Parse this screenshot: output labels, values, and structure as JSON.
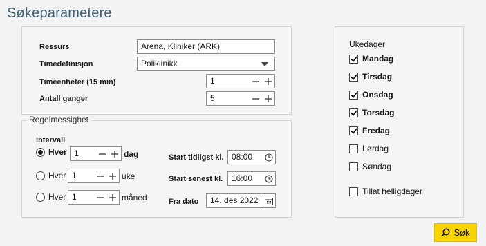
{
  "page": {
    "title": "Søkeparametere"
  },
  "params": {
    "ressurs_label": "Ressurs",
    "ressurs_value": "Arena, Kliniker (ARK)",
    "timedef_label": "Timedefinisjon",
    "timedef_value": "Poliklinikk",
    "timeenheter_label": "Timeenheter (15 min)",
    "timeenheter_value": "1",
    "antall_label": "Antall ganger",
    "antall_value": "5"
  },
  "regel": {
    "group_title": "Regelmessighet",
    "intervall_label": "Intervall",
    "rows": [
      {
        "prefix": "Hver",
        "value": "1",
        "unit": "dag",
        "selected": true
      },
      {
        "prefix": "Hver",
        "value": "1",
        "unit": "uke",
        "selected": false
      },
      {
        "prefix": "Hver",
        "value": "1",
        "unit": "måned",
        "selected": false
      }
    ],
    "start_tidligst_label": "Start tidligst kl.",
    "start_tidligst_value": "08:00",
    "start_senest_label": "Start senest kl.",
    "start_senest_value": "16:00",
    "fra_dato_label": "Fra dato",
    "fra_dato_value": "14. des 2022"
  },
  "ukedager": {
    "title": "Ukedager",
    "days": [
      {
        "label": "Mandag",
        "checked": true
      },
      {
        "label": "Tirsdag",
        "checked": true
      },
      {
        "label": "Onsdag",
        "checked": true
      },
      {
        "label": "Torsdag",
        "checked": true
      },
      {
        "label": "Fredag",
        "checked": true
      },
      {
        "label": "Lørdag",
        "checked": false
      },
      {
        "label": "Søndag",
        "checked": false
      }
    ],
    "helligdager_label": "Tillat helligdager",
    "helligdager_checked": false
  },
  "actions": {
    "search_label": "Søk"
  },
  "colors": {
    "accent": "#f8d400",
    "title": "#3d5f74"
  }
}
